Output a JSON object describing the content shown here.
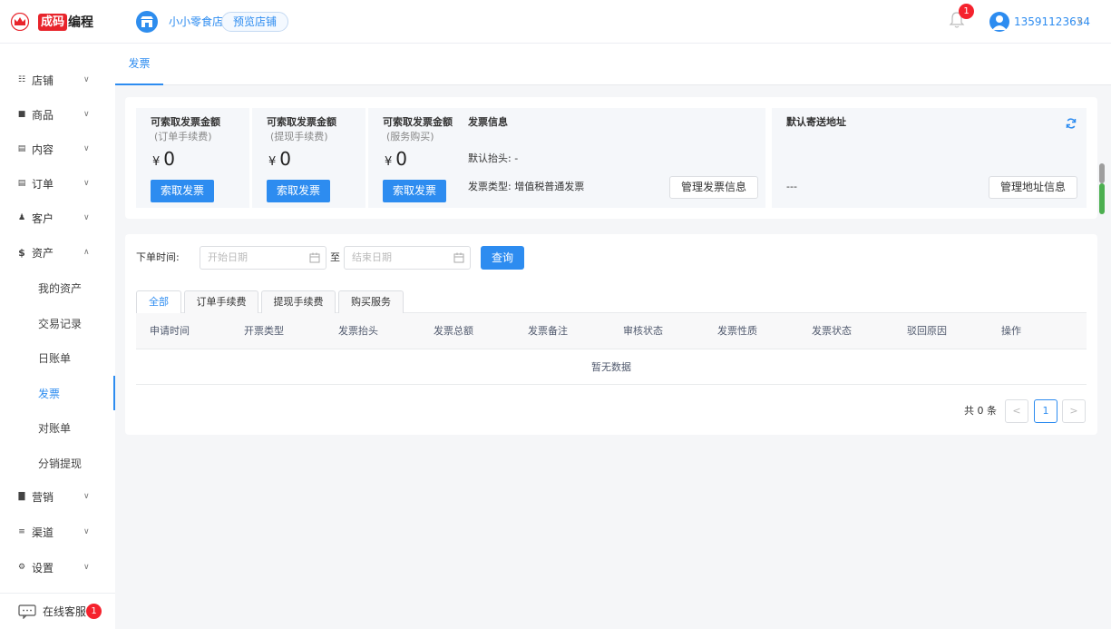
{
  "brand": {
    "badge": "成码",
    "text": "编程"
  },
  "header": {
    "store_name": "小小零食店",
    "preview_label": "预览店铺",
    "notification_count": "1",
    "user_phone": "13591123634"
  },
  "sidebar": {
    "items": [
      {
        "label": "店铺",
        "icon": "store-icon"
      },
      {
        "label": "商品",
        "icon": "goods-icon"
      },
      {
        "label": "内容",
        "icon": "content-icon"
      },
      {
        "label": "订单",
        "icon": "order-icon"
      },
      {
        "label": "客户",
        "icon": "customer-icon"
      },
      {
        "label": "资产",
        "icon": "dollar-icon"
      },
      {
        "label": "营销",
        "icon": "bar-chart-icon"
      },
      {
        "label": "渠道",
        "icon": "channel-icon"
      },
      {
        "label": "设置",
        "icon": "gear-icon"
      }
    ],
    "asset_sub": [
      "我的资产",
      "交易记录",
      "日账单",
      "发票",
      "对账单",
      "分销提现"
    ],
    "active_sub": "发票",
    "support_label": "在线客服",
    "support_count": "1"
  },
  "page_tab": "发票",
  "amounts": [
    {
      "title": "可索取发票金额",
      "sub": "(订单手续费)",
      "currency": "¥",
      "value": "0",
      "button": "索取发票"
    },
    {
      "title": "可索取发票金额",
      "sub": "(提现手续费)",
      "currency": "¥",
      "value": "0",
      "button": "索取发票"
    },
    {
      "title": "可索取发票金额",
      "sub": "(服务购买)",
      "currency": "¥",
      "value": "0",
      "button": "索取发票"
    }
  ],
  "invoice_info": {
    "title": "发票信息",
    "header_line": "默认抬头: -",
    "type_line": "发票类型: 增值税普通发票",
    "manage_button": "管理发票信息"
  },
  "address_info": {
    "title": "默认寄送地址",
    "value": "---",
    "manage_button": "管理地址信息"
  },
  "filter": {
    "label": "下单时间:",
    "start_placeholder": "开始日期",
    "to_label": "至",
    "end_placeholder": "结束日期",
    "query_button": "查询"
  },
  "tabs": [
    "全部",
    "订单手续费",
    "提现手续费",
    "购买服务"
  ],
  "table": {
    "columns": [
      "申请时间",
      "开票类型",
      "发票抬头",
      "发票总额",
      "发票备注",
      "审核状态",
      "发票性质",
      "发票状态",
      "驳回原因",
      "操作"
    ],
    "empty_text": "暂无数据"
  },
  "pager": {
    "total": "共 0 条",
    "current_page": "1",
    "prev": "<",
    "next": ">"
  },
  "colors": {
    "primary": "#2d8cf0",
    "badge_red": "#f5222d",
    "brand_red": "#e8242b"
  }
}
